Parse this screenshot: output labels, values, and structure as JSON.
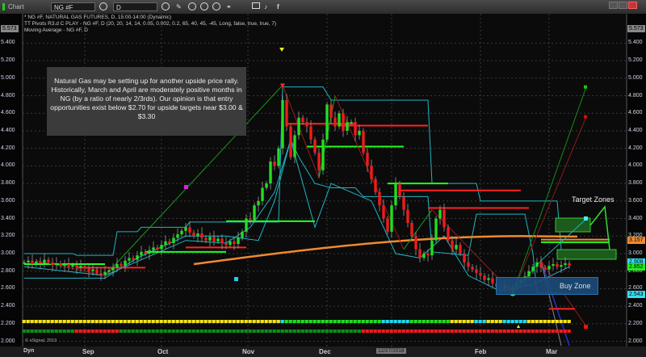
{
  "toolbar": {
    "app_label": "Chart",
    "symbol": "NG #F",
    "interval": "D",
    "icons": [
      "settings-icon",
      "clock-icon",
      "pencil-icon",
      "chart-style-icon",
      "play-icon",
      "alert-icon",
      "link-icon",
      "chat-icon",
      "twitter-icon",
      "facebook-icon"
    ]
  },
  "legend": {
    "line1": "* NG #F, NATURAL GAS FUTURES, D, 15:00-14:00 (Dynamic)",
    "line2": "TT Pivots R3.d C PLAY - NG #F, D (20, 20, 14, 14, 0.05, 0.002, 0.2, 65, 40, 45, -45, Long, false, true, true, 7)",
    "line3": "Moving Average - NG #F, D"
  },
  "note": "Natural Gas may be setting up for another upside price rally.  Historically, March and April are moderately positive months in NG (by a ratio of nearly 2/3rds).  Our opinion is that entry opportunities exist below $2.70 for upside targets near $3.00 & $3.30",
  "annotations": {
    "target_zones": "Target Zones",
    "buy_zone": "Buy Zone"
  },
  "copyright": "© eSignal, 2019",
  "colors": {
    "up": "#22dd22",
    "down": "#ee1c1c",
    "ma": "#f08a30",
    "channel": "#1fb5c4",
    "bg": "#0b0b0b"
  },
  "chart_data": {
    "type": "candlestick",
    "title": "",
    "ylim": [
      2.0,
      5.573
    ],
    "y_ticks": [
      "5.400",
      "5.200",
      "5.000",
      "4.800",
      "4.600",
      "4.400",
      "4.200",
      "4.000",
      "3.800",
      "3.600",
      "3.400",
      "3.200",
      "3.000",
      "2.800",
      "2.600",
      "2.400",
      "2.200",
      "2.000"
    ],
    "top_price_tag": "5.573",
    "x_labels": [
      "Sep",
      "Oct",
      "Nov",
      "Dec",
      "Feb",
      "Mar"
    ],
    "cursor_date": "12/27/2018",
    "dyn_label": "Dyn",
    "price_tags": [
      {
        "value": "3.157",
        "color": "#f08a30"
      },
      {
        "value": "2.908",
        "color": "#33e0ee"
      },
      {
        "value": "2.852",
        "color": "#22ee22"
      },
      {
        "value": "2.543",
        "color": "#33e0ee"
      }
    ],
    "closes": [
      2.9,
      2.92,
      2.88,
      2.91,
      2.89,
      2.93,
      2.9,
      2.87,
      2.89,
      2.86,
      2.88,
      2.85,
      2.87,
      2.84,
      2.86,
      2.83,
      2.8,
      2.82,
      2.78,
      2.76,
      2.79,
      2.81,
      2.84,
      2.88,
      2.86,
      2.92,
      2.95,
      2.93,
      2.98,
      3.02,
      3.0,
      3.04,
      3.07,
      3.05,
      3.1,
      3.14,
      3.12,
      3.18,
      3.22,
      3.26,
      3.3,
      3.24,
      3.2,
      3.23,
      3.18,
      3.15,
      3.19,
      3.14,
      3.17,
      3.12,
      3.1,
      3.14,
      3.11,
      3.18,
      3.25,
      3.4,
      3.38,
      3.55,
      3.6,
      3.75,
      3.8,
      4.05,
      4.0,
      4.2,
      4.75,
      4.45,
      4.1,
      4.35,
      4.55,
      4.5,
      4.45,
      4.3,
      4.15,
      3.95,
      4.3,
      4.7,
      4.55,
      4.45,
      4.6,
      4.4,
      4.5,
      4.5,
      4.35,
      4.4,
      4.15,
      4.0,
      3.85,
      3.7,
      3.55,
      3.4,
      3.25,
      3.55,
      3.8,
      3.65,
      3.5,
      3.35,
      3.2,
      3.05,
      2.95,
      3.0,
      2.98,
      3.15,
      3.4,
      3.5,
      3.3,
      3.15,
      3.05,
      3.1,
      3.0,
      2.9,
      2.85,
      2.82,
      2.78,
      2.75,
      2.7,
      2.72,
      2.66,
      2.62,
      2.6,
      2.64,
      2.58,
      2.62,
      2.66,
      2.7,
      2.74,
      2.8,
      2.85,
      2.9,
      2.84,
      2.82,
      2.86,
      2.88,
      2.85,
      2.87,
      2.89,
      2.86
    ],
    "indicator_rows": [
      [
        [
          "#f2e21a",
          0,
          63
        ],
        [
          "#22d8ee",
          64,
          64
        ],
        [
          "#22dd22",
          65,
          88
        ],
        [
          "#22d8ee",
          89,
          95
        ],
        [
          "#22dd22",
          96,
          105
        ],
        [
          "#f2e21a",
          106,
          111
        ],
        [
          "#22d8ee",
          112,
          114
        ],
        [
          "#f2e21a",
          115,
          118
        ],
        [
          "#22d8ee",
          119,
          124
        ],
        [
          "#f2e21a",
          125,
          135
        ]
      ],
      [
        [
          "#0f8f1a",
          0,
          12
        ],
        [
          "#ee1c1c",
          13,
          23
        ],
        [
          "#0f8f1a",
          24,
          83
        ],
        [
          "#ee1c1c",
          84,
          135
        ]
      ]
    ]
  }
}
